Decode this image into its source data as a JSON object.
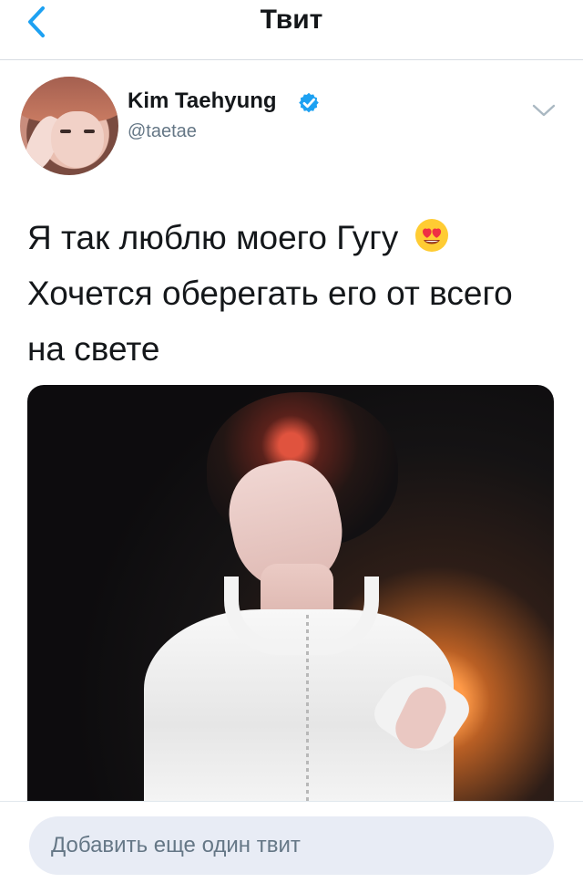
{
  "header": {
    "title": "Твит",
    "back_icon": "chevron-left-icon",
    "accent": "#1da1f2"
  },
  "tweet": {
    "author_name": "Kim Taehyung",
    "author_handle": "@taetae",
    "verified_icon": "verified-badge-icon",
    "menu_icon": "chevron-down-icon",
    "text_lines": [
      "Я так люблю моего Гугу",
      "Хочется оберегать его от всего",
      "на свете"
    ],
    "emoji": "smiling-face-with-heart-eyes"
  },
  "composer": {
    "placeholder": "Добавить еще один твит",
    "background": "#e8ecf5"
  }
}
